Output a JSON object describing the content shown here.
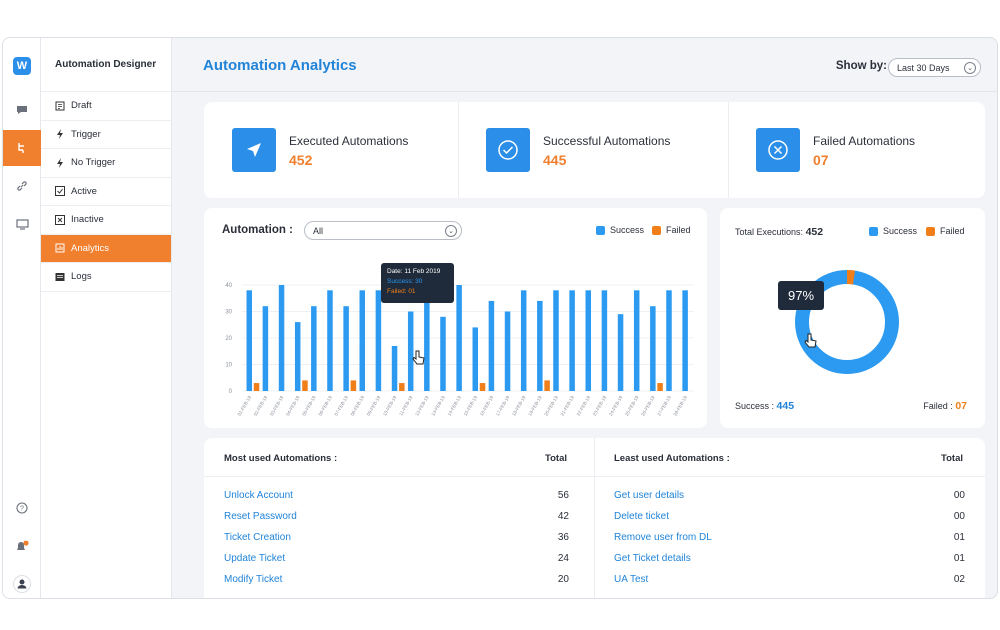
{
  "sidebar": {
    "title": "Automation Designer",
    "items": [
      {
        "label": "Draft",
        "icon": "draft-icon"
      },
      {
        "label": "Trigger",
        "icon": "bolt-icon"
      },
      {
        "label": "No Trigger",
        "icon": "bolt-off-icon"
      },
      {
        "label": "Active",
        "icon": "checkbox-icon"
      },
      {
        "label": "Inactive",
        "icon": "x-box-icon"
      },
      {
        "label": "Analytics",
        "icon": "chart-icon",
        "active": true
      },
      {
        "label": "Logs",
        "icon": "logs-icon"
      }
    ]
  },
  "rail": {
    "icons": [
      "logo-icon",
      "chat-icon",
      "automation-icon",
      "link-icon",
      "monitor-icon",
      "help-icon",
      "bell-icon",
      "user-icon"
    ],
    "notification_badge": "0"
  },
  "header": {
    "title": "Automation Analytics",
    "show_by_label": "Show by:",
    "show_by_value": "Last 30 Days"
  },
  "kpis": [
    {
      "label": "Executed Automations",
      "value": "452",
      "icon": "send-icon"
    },
    {
      "label": "Successful Automations",
      "value": "445",
      "icon": "check-circle-icon"
    },
    {
      "label": "Failed Automations",
      "value": "07",
      "icon": "x-circle-icon"
    }
  ],
  "chart_panel": {
    "label": "Automation :",
    "filter_value": "All",
    "legend_success": "Success",
    "legend_failed": "Failed",
    "tooltip": {
      "date": "Date: 11 Feb 2019",
      "success": "Success: 30",
      "failed": "Failed: 01"
    }
  },
  "chart_data": {
    "type": "bar",
    "categories": [
      "01-FEB-19",
      "02-FEB-19",
      "03-FEB-19",
      "04-FEB-19",
      "05-FEB-19",
      "06-FEB-19",
      "07-FEB-19",
      "08-FEB-19",
      "09-FEB-19",
      "10-FEB-19",
      "11-FEB-19",
      "12-FEB-19",
      "13-FEB-19",
      "14-FEB-19",
      "15-FEB-19",
      "16-FEB-19",
      "17-FEB-19",
      "18-FEB-19",
      "19-FEB-19",
      "20-FEB-19",
      "21-FEB-19",
      "22-FEB-19",
      "23-FEB-19",
      "24-FEB-19",
      "25-FEB-19",
      "26-FEB-19",
      "27-FEB-19",
      "28-FEB-19"
    ],
    "series": [
      {
        "name": "Success",
        "values": [
          38,
          32,
          40,
          26,
          32,
          38,
          32,
          38,
          38,
          17,
          30,
          38,
          28,
          40,
          24,
          34,
          30,
          38,
          34,
          38,
          38,
          38,
          38,
          29,
          38,
          32,
          38,
          38
        ]
      },
      {
        "name": "Failed",
        "values": [
          0,
          3,
          0,
          0,
          4,
          0,
          0,
          4,
          0,
          0,
          3,
          0,
          0,
          0,
          0,
          3,
          0,
          0,
          0,
          4,
          0,
          0,
          0,
          0,
          0,
          0,
          3,
          0
        ]
      }
    ],
    "ylim": [
      0,
      40
    ],
    "yticks": [
      0,
      10,
      20,
      30,
      40
    ],
    "colors": {
      "Success": "#2b9af0",
      "Failed": "#f07f1a"
    }
  },
  "donut": {
    "total_label": "Total Executions:",
    "total_value": "452",
    "legend_success": "Success",
    "legend_failed": "Failed",
    "percent_label": "97%",
    "success_label": "Success :",
    "success_value": "445",
    "failed_label": "Failed :",
    "failed_value": "07",
    "success_count": 445,
    "failed_count": 7
  },
  "most_used": {
    "title": "Most used Automations :",
    "total_header": "Total",
    "rows": [
      {
        "name": "Unlock Account",
        "total": "56"
      },
      {
        "name": "Reset Password",
        "total": "42"
      },
      {
        "name": "Ticket Creation",
        "total": "36"
      },
      {
        "name": "Update Ticket",
        "total": "24"
      },
      {
        "name": "Modify Ticket",
        "total": "20"
      }
    ]
  },
  "least_used": {
    "title": "Least used Automations :",
    "total_header": "Total",
    "rows": [
      {
        "name": "Get user details",
        "total": "00"
      },
      {
        "name": "Delete ticket",
        "total": "00"
      },
      {
        "name": "Remove user from DL",
        "total": "01"
      },
      {
        "name": "Get Ticket details",
        "total": "01"
      },
      {
        "name": "UA Test",
        "total": "02"
      }
    ]
  },
  "colors": {
    "accent": "#f07f2e",
    "primary": "#2b8ee8",
    "link": "#2184d9"
  }
}
